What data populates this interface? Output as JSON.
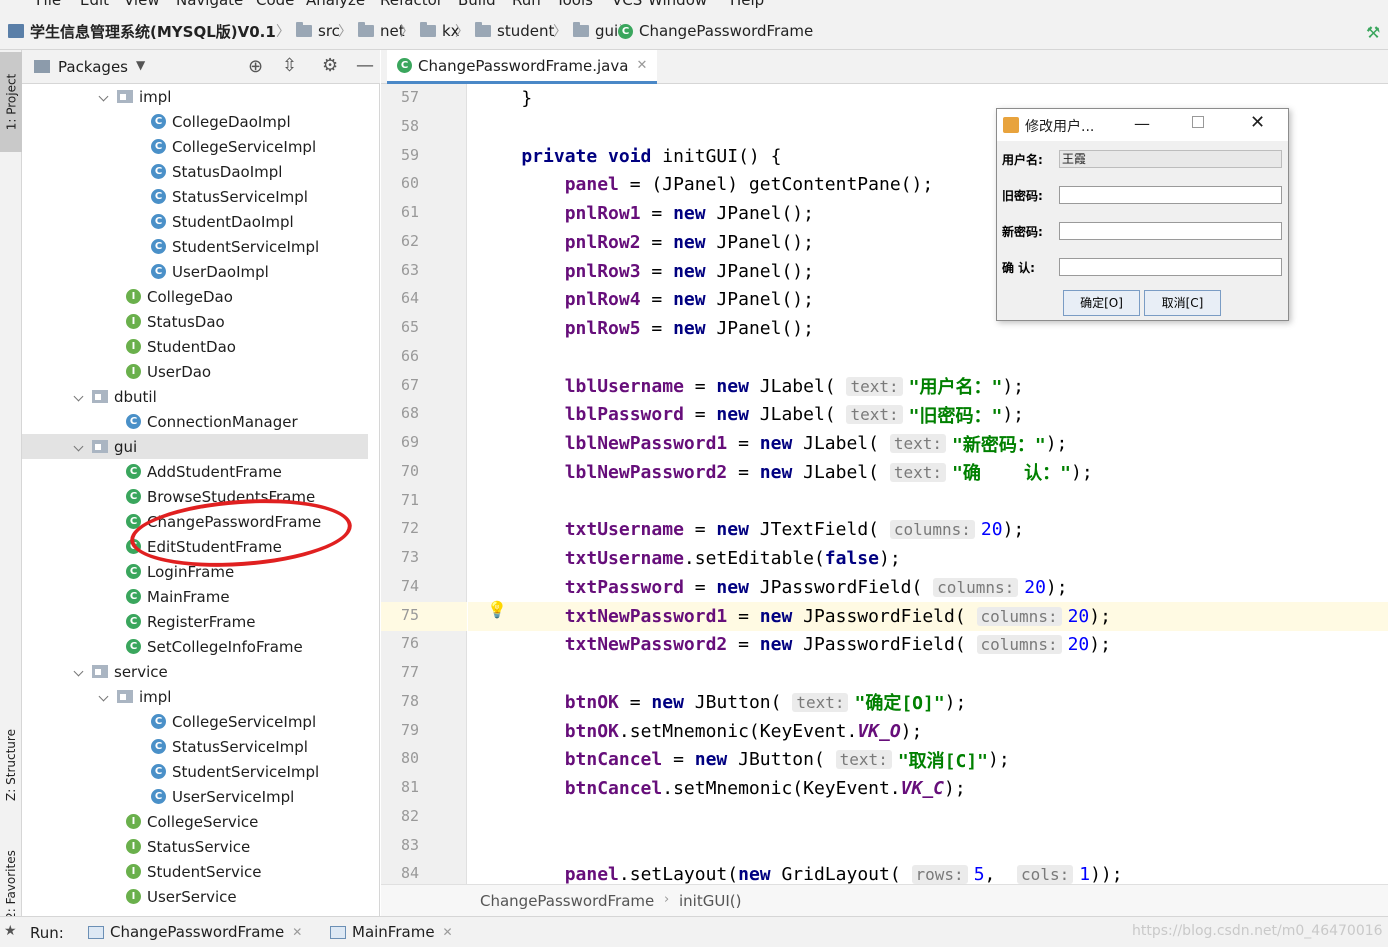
{
  "menu": [
    "File",
    "Edit",
    "View",
    "Navigate",
    "Code",
    "Analyze",
    "Refactor",
    "Build",
    "Run",
    "Tools",
    "VCS",
    "Window",
    "Help"
  ],
  "nav": {
    "project": "学生信息管理系统(MYSQL版)V0.1",
    "crumbs": [
      "src",
      "net",
      "kx",
      "student",
      "gui"
    ],
    "file": "ChangePasswordFrame"
  },
  "side_tabs": {
    "project": "1: Project",
    "structure": "Z: Structure",
    "favorites": "2: Favorites"
  },
  "project_panel": {
    "view_label": "Packages",
    "tree": [
      {
        "label": "impl",
        "kind": "package",
        "indent": 1,
        "expanded": true
      },
      {
        "label": "CollegeDaoImpl",
        "kind": "class",
        "indent": 2
      },
      {
        "label": "CollegeServiceImpl",
        "kind": "class",
        "indent": 2
      },
      {
        "label": "StatusDaoImpl",
        "kind": "class",
        "indent": 2
      },
      {
        "label": "StatusServiceImpl",
        "kind": "class",
        "indent": 2
      },
      {
        "label": "StudentDaoImpl",
        "kind": "class",
        "indent": 2
      },
      {
        "label": "StudentServiceImpl",
        "kind": "class",
        "indent": 2
      },
      {
        "label": "UserDaoImpl",
        "kind": "class",
        "indent": 2
      },
      {
        "label": "CollegeDao",
        "kind": "interface",
        "indent": 1
      },
      {
        "label": "StatusDao",
        "kind": "interface",
        "indent": 1
      },
      {
        "label": "StudentDao",
        "kind": "interface",
        "indent": 1
      },
      {
        "label": "UserDao",
        "kind": "interface",
        "indent": 1
      },
      {
        "label": "dbutil",
        "kind": "package",
        "indent": 0,
        "expanded": true
      },
      {
        "label": "ConnectionManager",
        "kind": "class",
        "indent": 1
      },
      {
        "label": "gui",
        "kind": "package",
        "indent": 0,
        "expanded": true,
        "selected": true
      },
      {
        "label": "AddStudentFrame",
        "kind": "frame",
        "indent": 1
      },
      {
        "label": "BrowseStudentsFrame",
        "kind": "frame",
        "indent": 1
      },
      {
        "label": "ChangePasswordFrame",
        "kind": "frame",
        "indent": 1
      },
      {
        "label": "EditStudentFrame",
        "kind": "frame",
        "indent": 1
      },
      {
        "label": "LoginFrame",
        "kind": "frame",
        "indent": 1
      },
      {
        "label": "MainFrame",
        "kind": "frame",
        "indent": 1
      },
      {
        "label": "RegisterFrame",
        "kind": "frame",
        "indent": 1
      },
      {
        "label": "SetCollegeInfoFrame",
        "kind": "frame",
        "indent": 1
      },
      {
        "label": "service",
        "kind": "package",
        "indent": 0,
        "expanded": true
      },
      {
        "label": "impl",
        "kind": "package",
        "indent": 1,
        "expanded": true
      },
      {
        "label": "CollegeServiceImpl",
        "kind": "class",
        "indent": 2
      },
      {
        "label": "StatusServiceImpl",
        "kind": "class",
        "indent": 2
      },
      {
        "label": "StudentServiceImpl",
        "kind": "class",
        "indent": 2
      },
      {
        "label": "UserServiceImpl",
        "kind": "class",
        "indent": 2
      },
      {
        "label": "CollegeService",
        "kind": "interface",
        "indent": 1
      },
      {
        "label": "StatusService",
        "kind": "interface",
        "indent": 1
      },
      {
        "label": "StudentService",
        "kind": "interface",
        "indent": 1
      },
      {
        "label": "UserService",
        "kind": "interface",
        "indent": 1
      }
    ]
  },
  "editor": {
    "tab": "ChangePasswordFrame.java",
    "lines": [
      {
        "n": "57",
        "parts": [
          [
            "t",
            "    }"
          ]
        ]
      },
      {
        "n": "58",
        "parts": []
      },
      {
        "n": "59",
        "parts": [
          [
            "kw",
            "    private void "
          ],
          [
            "t",
            "initGUI() {"
          ]
        ]
      },
      {
        "n": "60",
        "parts": [
          [
            "fld",
            "        panel"
          ],
          [
            "t",
            " = (JPanel) getContentPane();"
          ]
        ]
      },
      {
        "n": "61",
        "parts": [
          [
            "fld",
            "        pnlRow1"
          ],
          [
            "t",
            " = "
          ],
          [
            "kw",
            "new "
          ],
          [
            "t",
            "JPanel();"
          ]
        ]
      },
      {
        "n": "62",
        "parts": [
          [
            "fld",
            "        pnlRow2"
          ],
          [
            "t",
            " = "
          ],
          [
            "kw",
            "new "
          ],
          [
            "t",
            "JPanel();"
          ]
        ]
      },
      {
        "n": "63",
        "parts": [
          [
            "fld",
            "        pnlRow3"
          ],
          [
            "t",
            " = "
          ],
          [
            "kw",
            "new "
          ],
          [
            "t",
            "JPanel();"
          ]
        ]
      },
      {
        "n": "64",
        "parts": [
          [
            "fld",
            "        pnlRow4"
          ],
          [
            "t",
            " = "
          ],
          [
            "kw",
            "new "
          ],
          [
            "t",
            "JPanel();"
          ]
        ]
      },
      {
        "n": "65",
        "parts": [
          [
            "fld",
            "        pnlRow5"
          ],
          [
            "t",
            " = "
          ],
          [
            "kw",
            "new "
          ],
          [
            "t",
            "JPanel();"
          ]
        ]
      },
      {
        "n": "66",
        "parts": []
      },
      {
        "n": "67",
        "parts": [
          [
            "fld",
            "        lblUsername"
          ],
          [
            "t",
            " = "
          ],
          [
            "kw",
            "new "
          ],
          [
            "t",
            "JLabel( "
          ],
          [
            "hint",
            "text:"
          ],
          [
            "str",
            "\"用户名：\""
          ],
          [
            "t",
            ");"
          ]
        ]
      },
      {
        "n": "68",
        "parts": [
          [
            "fld",
            "        lblPassword"
          ],
          [
            "t",
            " = "
          ],
          [
            "kw",
            "new "
          ],
          [
            "t",
            "JLabel( "
          ],
          [
            "hint",
            "text:"
          ],
          [
            "str",
            "\"旧密码：\""
          ],
          [
            "t",
            ");"
          ]
        ]
      },
      {
        "n": "69",
        "parts": [
          [
            "fld",
            "        lblNewPassword1"
          ],
          [
            "t",
            " = "
          ],
          [
            "kw",
            "new "
          ],
          [
            "t",
            "JLabel( "
          ],
          [
            "hint",
            "text:"
          ],
          [
            "str",
            "\"新密码：\""
          ],
          [
            "t",
            ");"
          ]
        ]
      },
      {
        "n": "70",
        "parts": [
          [
            "fld",
            "        lblNewPassword2"
          ],
          [
            "t",
            " = "
          ],
          [
            "kw",
            "new "
          ],
          [
            "t",
            "JLabel( "
          ],
          [
            "hint",
            "text:"
          ],
          [
            "str",
            "\"确    认：\""
          ],
          [
            "t",
            ");"
          ]
        ]
      },
      {
        "n": "71",
        "parts": []
      },
      {
        "n": "72",
        "parts": [
          [
            "fld",
            "        txtUsername"
          ],
          [
            "t",
            " = "
          ],
          [
            "kw",
            "new "
          ],
          [
            "t",
            "JTextField( "
          ],
          [
            "hint",
            "columns:"
          ],
          [
            "num",
            "20"
          ],
          [
            "t",
            ");"
          ]
        ]
      },
      {
        "n": "73",
        "parts": [
          [
            "fld",
            "        txtUsername"
          ],
          [
            "t",
            ".setEditable("
          ],
          [
            "kw",
            "false"
          ],
          [
            "t",
            ");"
          ]
        ]
      },
      {
        "n": "74",
        "parts": [
          [
            "fld",
            "        txtPassword"
          ],
          [
            "t",
            " = "
          ],
          [
            "kw",
            "new "
          ],
          [
            "t",
            "JPasswordField( "
          ],
          [
            "hint",
            "columns:"
          ],
          [
            "num",
            "20"
          ],
          [
            "t",
            ");"
          ]
        ]
      },
      {
        "n": "75",
        "parts": [
          [
            "fld",
            "        txtNewPassword1"
          ],
          [
            "t",
            " = "
          ],
          [
            "kw",
            "new "
          ],
          [
            "t",
            "JPasswordField( "
          ],
          [
            "hint",
            "columns:"
          ],
          [
            "num",
            "20"
          ],
          [
            "t",
            ");"
          ]
        ],
        "highlight": true
      },
      {
        "n": "76",
        "parts": [
          [
            "fld",
            "        txtNewPassword2"
          ],
          [
            "t",
            " = "
          ],
          [
            "kw",
            "new "
          ],
          [
            "t",
            "JPasswordField( "
          ],
          [
            "hint",
            "columns:"
          ],
          [
            "num",
            "20"
          ],
          [
            "t",
            ");"
          ]
        ]
      },
      {
        "n": "77",
        "parts": []
      },
      {
        "n": "78",
        "parts": [
          [
            "fld",
            "        btnOK"
          ],
          [
            "t",
            " = "
          ],
          [
            "kw",
            "new "
          ],
          [
            "t",
            "JButton( "
          ],
          [
            "hint",
            "text:"
          ],
          [
            "str",
            "\"确定[O]\""
          ],
          [
            "t",
            ");"
          ]
        ]
      },
      {
        "n": "79",
        "parts": [
          [
            "fld",
            "        btnOK"
          ],
          [
            "t",
            ".setMnemonic(KeyEvent."
          ],
          [
            "sfld",
            "VK_O"
          ],
          [
            "t",
            ");"
          ]
        ]
      },
      {
        "n": "80",
        "parts": [
          [
            "fld",
            "        btnCancel"
          ],
          [
            "t",
            " = "
          ],
          [
            "kw",
            "new "
          ],
          [
            "t",
            "JButton( "
          ],
          [
            "hint",
            "text:"
          ],
          [
            "str",
            "\"取消[C]\""
          ],
          [
            "t",
            ");"
          ]
        ]
      },
      {
        "n": "81",
        "parts": [
          [
            "fld",
            "        btnCancel"
          ],
          [
            "t",
            ".setMnemonic(KeyEvent."
          ],
          [
            "sfld",
            "VK_C"
          ],
          [
            "t",
            ");"
          ]
        ]
      },
      {
        "n": "82",
        "parts": []
      },
      {
        "n": "83",
        "parts": []
      },
      {
        "n": "84",
        "parts": [
          [
            "fld",
            "        panel"
          ],
          [
            "t",
            ".setLayout("
          ],
          [
            "kw",
            "new "
          ],
          [
            "t",
            "GridLayout( "
          ],
          [
            "hint",
            "rows:"
          ],
          [
            "num",
            "5"
          ],
          [
            "t",
            ",  "
          ],
          [
            "hint",
            "cols:"
          ],
          [
            "num",
            "1"
          ],
          [
            "t",
            "));"
          ]
        ]
      }
    ],
    "breadcrumb": [
      "ChangePasswordFrame",
      "initGUI()"
    ]
  },
  "dialog": {
    "title": "修改用户...",
    "fields": [
      {
        "label": "用户名:",
        "value": "王霞"
      },
      {
        "label": "旧密码:",
        "value": ""
      },
      {
        "label": "新密码:",
        "value": ""
      },
      {
        "label": "确  认:",
        "value": ""
      }
    ],
    "ok": "确定[O]",
    "cancel": "取消[C]"
  },
  "runbar": {
    "label": "Run:",
    "tabs": [
      "ChangePasswordFrame",
      "MainFrame"
    ]
  },
  "watermark": "https://blog.csdn.net/m0_46470016",
  "colors": {
    "annotation": "#e02020",
    "keyword": "#000080",
    "field": "#660e7a",
    "string": "#008000"
  }
}
